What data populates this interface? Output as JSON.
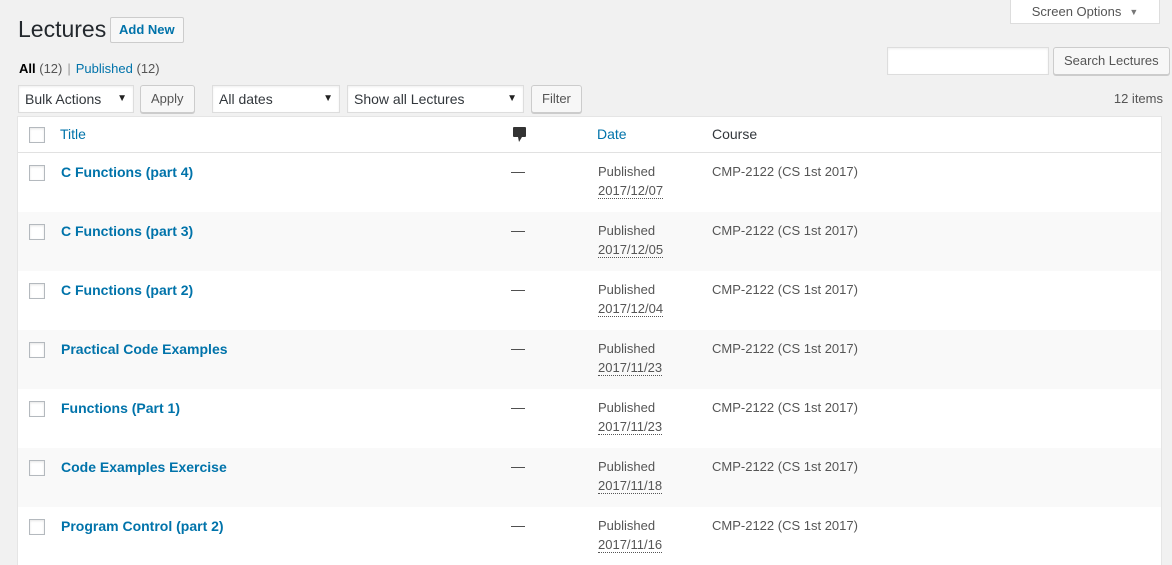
{
  "screen_options": {
    "label": "Screen Options",
    "arrow": "▼"
  },
  "header": {
    "title": "Lectures",
    "add_new": "Add New"
  },
  "views": {
    "all_label": "All",
    "all_count": "(12)",
    "separator": "|",
    "published_label": "Published",
    "published_count": "(12)"
  },
  "search": {
    "placeholder": "",
    "button": "Search Lectures"
  },
  "filters": {
    "bulk_actions": "Bulk Actions",
    "apply": "Apply",
    "dates": "All dates",
    "lectures": "Show all Lectures",
    "filter": "Filter",
    "caret": "▼"
  },
  "item_count": "12 items",
  "table": {
    "columns": {
      "title": "Title",
      "comments_icon": "comment-bubble-icon",
      "date": "Date",
      "course": "Course"
    },
    "rows": [
      {
        "title": "C Functions (part 4)",
        "comments": "—",
        "status": "Published",
        "date": "2017/12/07",
        "course": "CMP-2122 (CS 1st 2017)"
      },
      {
        "title": "C Functions (part 3)",
        "comments": "—",
        "status": "Published",
        "date": "2017/12/05",
        "course": "CMP-2122 (CS 1st 2017)"
      },
      {
        "title": "C Functions (part 2)",
        "comments": "—",
        "status": "Published",
        "date": "2017/12/04",
        "course": "CMP-2122 (CS 1st 2017)"
      },
      {
        "title": "Practical Code Examples",
        "comments": "—",
        "status": "Published",
        "date": "2017/11/23",
        "course": "CMP-2122 (CS 1st 2017)"
      },
      {
        "title": "Functions (Part 1)",
        "comments": "—",
        "status": "Published",
        "date": "2017/11/23",
        "course": "CMP-2122 (CS 1st 2017)"
      },
      {
        "title": "Code Examples Exercise",
        "comments": "—",
        "status": "Published",
        "date": "2017/11/18",
        "course": "CMP-2122 (CS 1st 2017)"
      },
      {
        "title": "Program Control (part 2)",
        "comments": "—",
        "status": "Published",
        "date": "2017/11/16",
        "course": "CMP-2122 (CS 1st 2017)"
      }
    ]
  }
}
